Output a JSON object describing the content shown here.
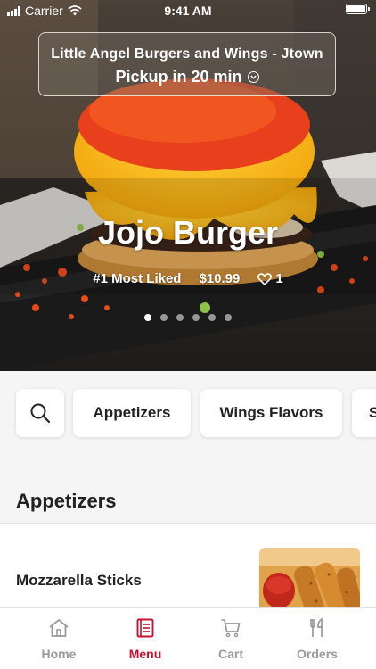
{
  "status_bar": {
    "carrier": "Carrier",
    "time": "9:41 AM"
  },
  "store": {
    "name": "Little Angel Burgers and Wings - Jtown",
    "pickup": "Pickup in 20 min",
    "chevron_icon": "chevron-down-circle-icon"
  },
  "featured": {
    "name": "Jojo Burger",
    "tag": "#1 Most Liked",
    "price": "$10.99",
    "likes": "1",
    "slides": 6,
    "active_slide": 1
  },
  "categories": {
    "search_icon": "search-icon",
    "items": [
      "Appetizers",
      "Wings Flavors",
      "S"
    ]
  },
  "section": {
    "title": "Appetizers"
  },
  "menu_items": [
    {
      "name": "Mozzarella Sticks"
    }
  ],
  "tabs": [
    {
      "label": "Home",
      "icon": "home-icon",
      "active": false
    },
    {
      "label": "Menu",
      "icon": "menu-icon",
      "active": true
    },
    {
      "label": "Cart",
      "icon": "cart-icon",
      "active": false
    },
    {
      "label": "Orders",
      "icon": "utensils-icon",
      "active": false
    }
  ],
  "colors": {
    "accent": "#c8102e",
    "inactive": "#9a9a9a",
    "background": "#f5f5f5"
  }
}
